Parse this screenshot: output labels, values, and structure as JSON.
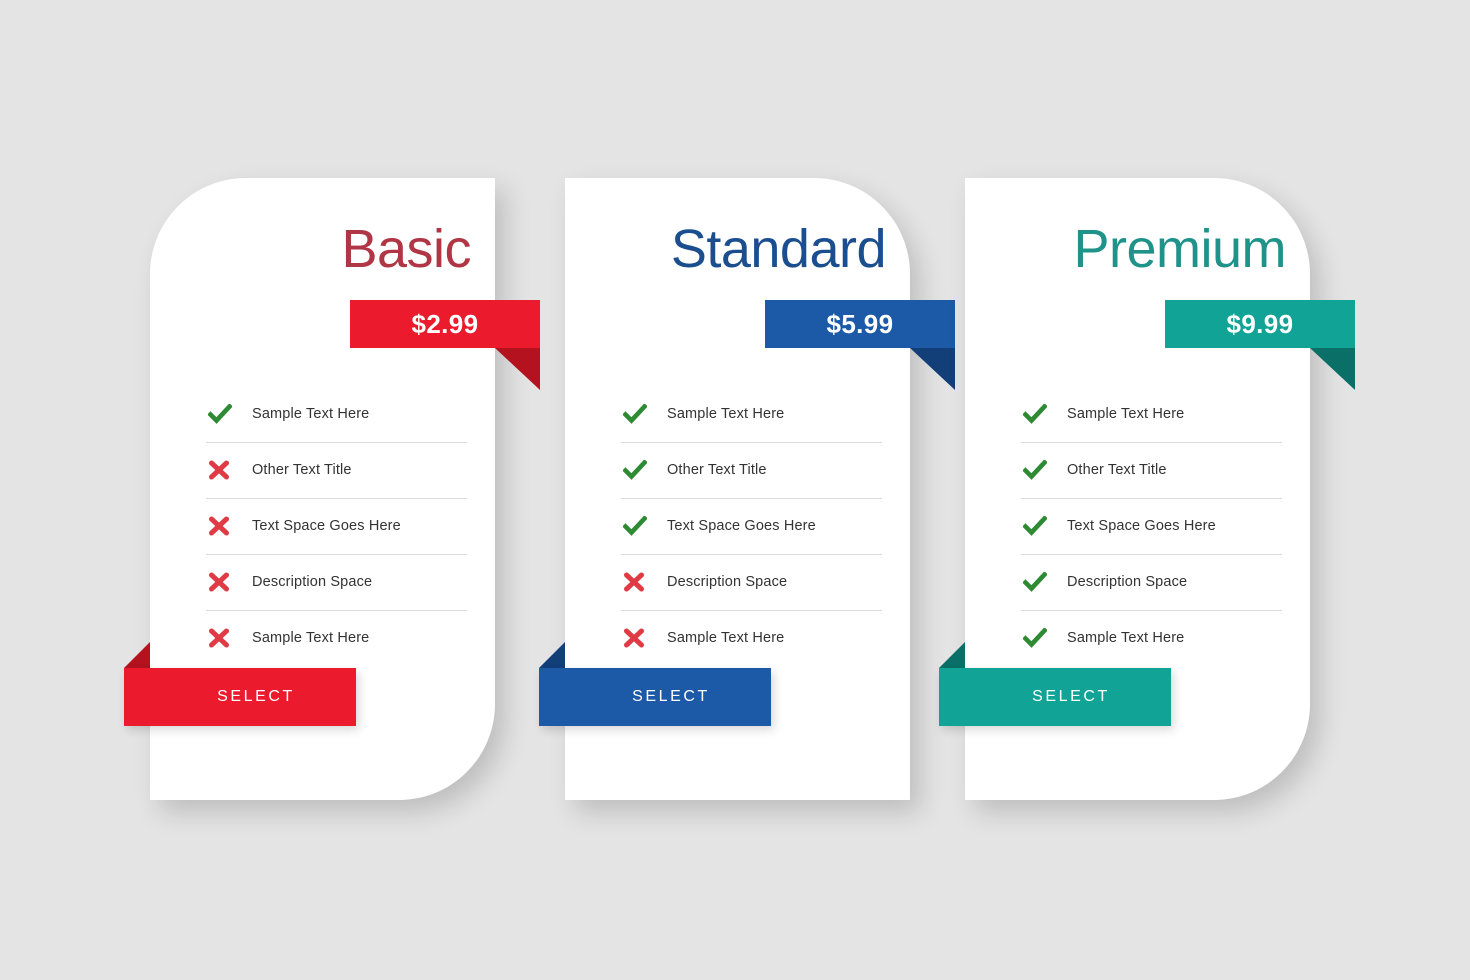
{
  "page": {
    "background_color": "#e4e4e4",
    "title": "Pricing Table"
  },
  "colors": {
    "basic_accent": "#eb1b2d",
    "basic_accent_dark": "#b4121f",
    "basic_title": "#b03545",
    "standard_accent": "#1c5aa8",
    "standard_accent_dark": "#123f78",
    "standard_title": "#1b4e8f",
    "premium_accent": "#10a396",
    "premium_accent_dark": "#0a6f66",
    "premium_title": "#1f9389",
    "check_green": "#2e8b33",
    "cross_red": "#e03a45",
    "feature_text": "#333333",
    "divider": "#dcdcdc",
    "card_bg": "#ffffff"
  },
  "icons": {
    "check": "check-icon",
    "cross": "cross-icon"
  },
  "plans": [
    {
      "id": "basic",
      "title": "Basic",
      "price": "$2.99",
      "select_label": "SELECT",
      "accent": "#eb1b2d",
      "accent_dark": "#b4121f",
      "title_color": "#b03545",
      "features": [
        {
          "label": "Sample Text Here",
          "included": true
        },
        {
          "label": "Other Text Title",
          "included": false
        },
        {
          "label": "Text Space Goes Here",
          "included": false
        },
        {
          "label": "Description Space",
          "included": false
        },
        {
          "label": "Sample Text Here",
          "included": false
        }
      ]
    },
    {
      "id": "standard",
      "title": "Standard",
      "price": "$5.99",
      "select_label": "SELECT",
      "accent": "#1c5aa8",
      "accent_dark": "#123f78",
      "title_color": "#1b4e8f",
      "features": [
        {
          "label": "Sample Text Here",
          "included": true
        },
        {
          "label": "Other Text Title",
          "included": true
        },
        {
          "label": "Text Space Goes Here",
          "included": true
        },
        {
          "label": "Description Space",
          "included": false
        },
        {
          "label": "Sample Text Here",
          "included": false
        }
      ]
    },
    {
      "id": "premium",
      "title": "Premium",
      "price": "$9.99",
      "select_label": "SELECT",
      "accent": "#10a396",
      "accent_dark": "#0a6f66",
      "title_color": "#1f9389",
      "features": [
        {
          "label": "Sample Text Here",
          "included": true
        },
        {
          "label": "Other Text Title",
          "included": true
        },
        {
          "label": "Text Space Goes Here",
          "included": true
        },
        {
          "label": "Description Space",
          "included": true
        },
        {
          "label": "Sample Text Here",
          "included": true
        }
      ]
    }
  ]
}
